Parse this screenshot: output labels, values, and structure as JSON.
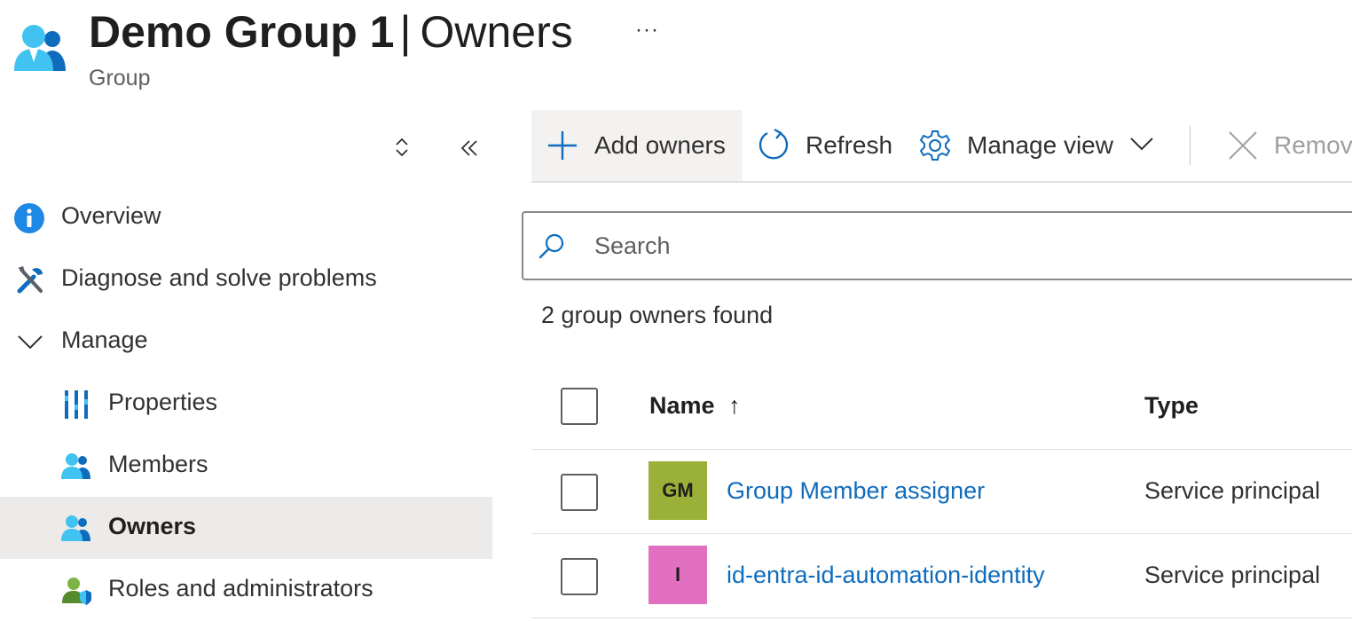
{
  "header": {
    "group_name": "Demo Group 1",
    "separator": "|",
    "page_name": "Owners",
    "more_actions": "···",
    "subtitle": "Group",
    "icon": "group-users-icon"
  },
  "sidebar": {
    "items": [
      {
        "label": "Overview",
        "icon": "info-icon"
      },
      {
        "label": "Diagnose and solve problems",
        "icon": "wrench-screwdriver-icon"
      },
      {
        "label": "Manage",
        "icon": "chevron-down-icon"
      },
      {
        "label": "Properties",
        "icon": "properties-icon"
      },
      {
        "label": "Members",
        "icon": "members-icon"
      },
      {
        "label": "Owners",
        "icon": "owners-icon",
        "selected": true
      },
      {
        "label": "Roles and administrators",
        "icon": "roles-icon"
      }
    ]
  },
  "toolbar": {
    "add_owners": "Add owners",
    "refresh": "Refresh",
    "manage_view": "Manage view",
    "remove": "Remov"
  },
  "search": {
    "placeholder": "Search"
  },
  "results": {
    "count_text": "2 group owners found"
  },
  "table": {
    "columns": {
      "name": "Name",
      "sort_indicator": "↑",
      "type": "Type"
    },
    "rows": [
      {
        "initials": "GM",
        "avatar_color": "#9bb038",
        "name": "Group Member assigner",
        "type": "Service principal"
      },
      {
        "initials": "I",
        "avatar_color": "#e171c0",
        "name": "id-entra-id-automation-identity",
        "type": "Service principal"
      }
    ]
  },
  "colors": {
    "accent": "#0f6cbd",
    "selected_bg": "#edebe9"
  }
}
